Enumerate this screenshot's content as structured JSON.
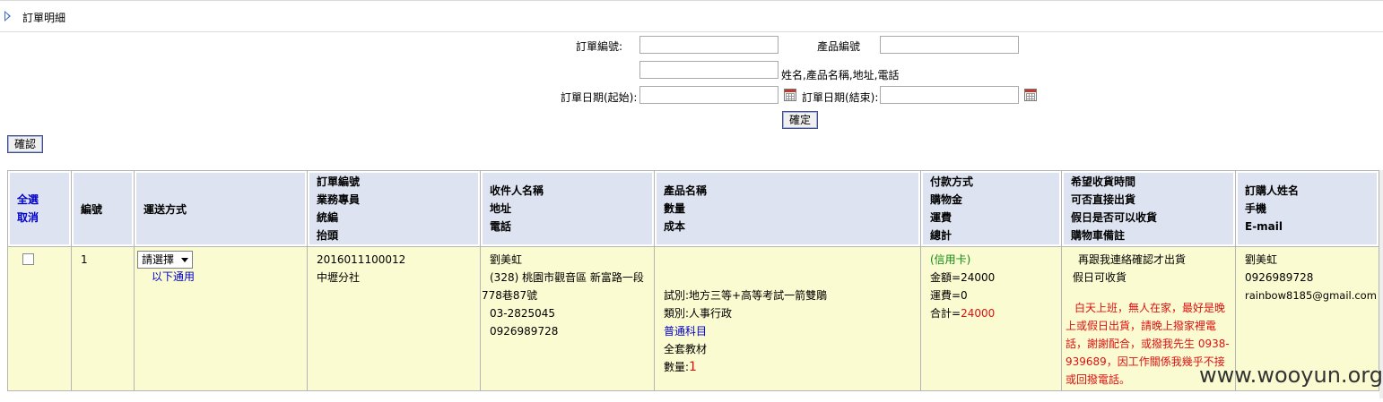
{
  "page": {
    "title": "訂單明細"
  },
  "filters": {
    "order_no_label": "訂單編號:",
    "product_no_label": "產品編號",
    "keyword_hint": "姓名,產品名稱,地址,電話",
    "date_start_label": "訂單日期(起始):",
    "date_end_label": "訂單日期(結束):",
    "submit_label": "確定",
    "order_no_value": "",
    "product_no_value": "",
    "keyword_value": "",
    "date_start_value": "",
    "date_end_value": ""
  },
  "confirm_button": "確認",
  "table": {
    "headers": {
      "select_all": "全選",
      "cancel": "取消",
      "no": "編號",
      "shipping": "運送方式",
      "order": [
        "訂單編號",
        "業務專員",
        "統編",
        "抬頭"
      ],
      "recipient": [
        "收件人名稱",
        "地址",
        "電話"
      ],
      "product": [
        "產品名稱",
        "數量",
        "成本"
      ],
      "payment": [
        "付款方式",
        "購物金",
        "運費",
        "總計"
      ],
      "delivery": [
        "希望收貨時間",
        "可否直接出貨",
        "假日是否可以收貨",
        "購物車備註"
      ],
      "buyer": [
        "訂購人姓名",
        "手機",
        "E-mail"
      ]
    },
    "rows": [
      {
        "no": "1",
        "shipping_select": "請選擇",
        "shipping_link": "以下通用",
        "order_no": "2016011100012",
        "branch": "中壢分社",
        "recipient_name": "劉美虹",
        "address_1": "(328) 桃園市觀音區  新富路一段",
        "address_2": "778巷87號",
        "phone": "03-2825045",
        "mobile": "0926989728",
        "product_1": "試別:地方三等+高等考試一箭雙鵰",
        "product_2": "類別:人事行政",
        "product_3": "普通科目",
        "product_4": "全套教材",
        "qty_label": "數量:",
        "qty_value": "1",
        "pay_method": "(信用卡)",
        "amount_label": "金額=",
        "amount_value": "24000",
        "shipping_fee": "運費=0",
        "total_label": "合計=",
        "total_value": "24000",
        "delivery_1": "再跟我連絡確認才出貨",
        "delivery_2": "假日可收貨",
        "note": "白天上班，無人在家，最好是晚上或假日出貨，請晚上撥家裡電話，謝謝配合，或撥我先生 0938-939689，因工作關係我幾乎不接或回撥電話。",
        "buyer_name": "劉美虹",
        "buyer_mobile": "0926989728",
        "buyer_email": "rainbow8185@gmail.com"
      }
    ]
  },
  "watermark": "www.wooyun.org",
  "colors": {
    "header_bg": "#dde3f0",
    "row_bg": "#fbfbd1",
    "link": "#0000cc",
    "accent_red": "#dd1111",
    "accent_green": "#118811"
  }
}
